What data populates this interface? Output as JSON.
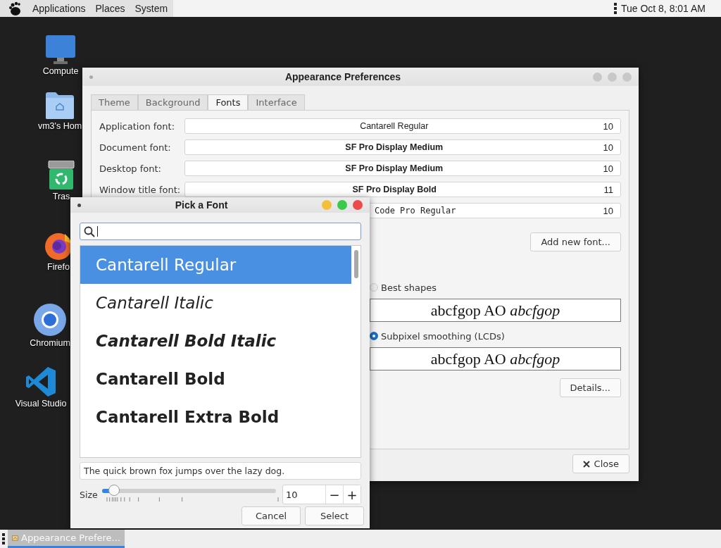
{
  "top_panel": {
    "menus": [
      "Applications",
      "Places",
      "System"
    ],
    "clock": "Tue Oct  8, 8:01 AM"
  },
  "desktop_icons": [
    {
      "kind": "computer",
      "label": "Compute"
    },
    {
      "kind": "home",
      "label": "vm3's Hom"
    },
    {
      "kind": "trash",
      "label": "Tras"
    },
    {
      "kind": "firefox",
      "label": "Firefo"
    },
    {
      "kind": "chromium",
      "label": "Chromium"
    },
    {
      "kind": "vscode",
      "label": "Visual Studio"
    }
  ],
  "appearance_window": {
    "title": "Appearance Preferences",
    "tabs": [
      {
        "label": "Theme",
        "selected": false
      },
      {
        "label": "Background",
        "selected": false
      },
      {
        "label": "Fonts",
        "selected": true
      },
      {
        "label": "Interface",
        "selected": false
      }
    ],
    "font_rows": [
      {
        "label": "Application font:",
        "font": "Cantarell Regular",
        "size": "10",
        "kind": "regular"
      },
      {
        "label": "Document font:",
        "font": "SF Pro Display Medium",
        "size": "10",
        "kind": "medium"
      },
      {
        "label": "Desktop font:",
        "font": "SF Pro Display Medium",
        "size": "10",
        "kind": "medium"
      },
      {
        "label": "Window title font:",
        "font": "SF Pro Display Bold",
        "size": "11",
        "kind": "bold"
      },
      {
        "font": "Code Pro Regular",
        "size": "10",
        "kind": "mono"
      }
    ],
    "add_font_button": "Add new font...",
    "rendering_options": [
      {
        "label": "Best shapes",
        "selected": false,
        "preview": "abcfgop AO *abcfgop*"
      },
      {
        "label": "Subpixel smoothing (LCDs)",
        "selected": true,
        "preview": "abcfgop AO *abcfgop*"
      }
    ],
    "details_button": "Details...",
    "close_button": "Close"
  },
  "font_dialog": {
    "title": "Pick a Font",
    "fonts": [
      {
        "name": "Cantarell Regular",
        "kind": "regular",
        "selected": true
      },
      {
        "name": "Cantarell Italic",
        "kind": "italic",
        "selected": false
      },
      {
        "name": "Cantarell Bold Italic",
        "kind": "bold-italic",
        "selected": false
      },
      {
        "name": "Cantarell Bold",
        "kind": "bold",
        "selected": false
      },
      {
        "name": "Cantarell Extra Bold",
        "kind": "extra-bold",
        "selected": false
      }
    ],
    "preview_text": "The quick brown fox jumps over the lazy dog.",
    "size_label": "Size",
    "size_slider": {
      "level": 0.07
    },
    "size_value": "10",
    "decrement": "−",
    "increment": "+",
    "buttons": [
      "Cancel",
      "Select"
    ]
  },
  "taskbar": {
    "items": [
      {
        "label": "Appearance Prefere...",
        "selected": true
      }
    ]
  }
}
